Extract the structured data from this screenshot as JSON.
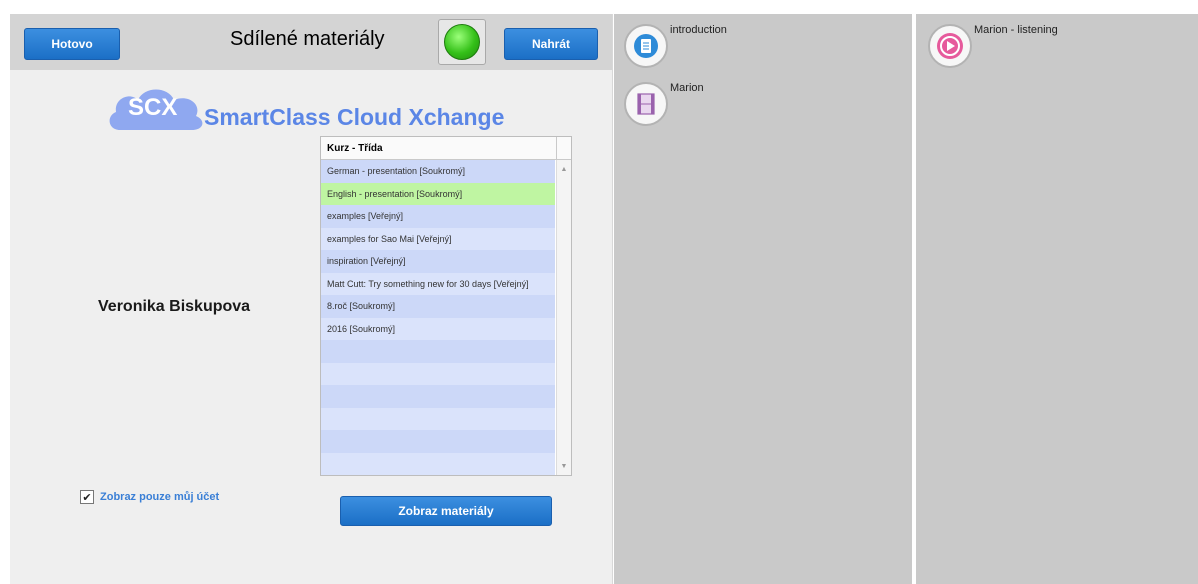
{
  "toolbar": {
    "done_label": "Hotovo",
    "title": "Sdílené materiály",
    "upload_label": "Nahrát",
    "status_color": "#34c018"
  },
  "logo": {
    "short": "SCX",
    "name": "SmartClass Cloud Xchange",
    "color": "#5b86e6"
  },
  "user": {
    "name": "Veronika Biskupova"
  },
  "course_list": {
    "header": "Kurz - Třída",
    "selected_index": 1,
    "items": [
      "German - presentation [Soukromý]",
      "English - presentation [Soukromý]",
      "examples [Veřejný]",
      "examples for Sao Mai [Veřejný]",
      "inspiration [Veřejný]",
      "Matt Cutt: Try something new for 30 days [Veřejný]",
      "8.roč [Soukromý]",
      "2016 [Soukromý]"
    ],
    "empty_rows": 6
  },
  "filter": {
    "checkbox_checked": true,
    "checkbox_label": "Zobraz pouze můj účet"
  },
  "show_button_label": "Zobraz materiály",
  "files_middle": [
    {
      "label": "introduction",
      "icon": "document-icon"
    },
    {
      "label": "Marion",
      "icon": "video-film-icon"
    }
  ],
  "files_right": [
    {
      "label": "Marion - listening",
      "icon": "play-audio-icon"
    }
  ]
}
